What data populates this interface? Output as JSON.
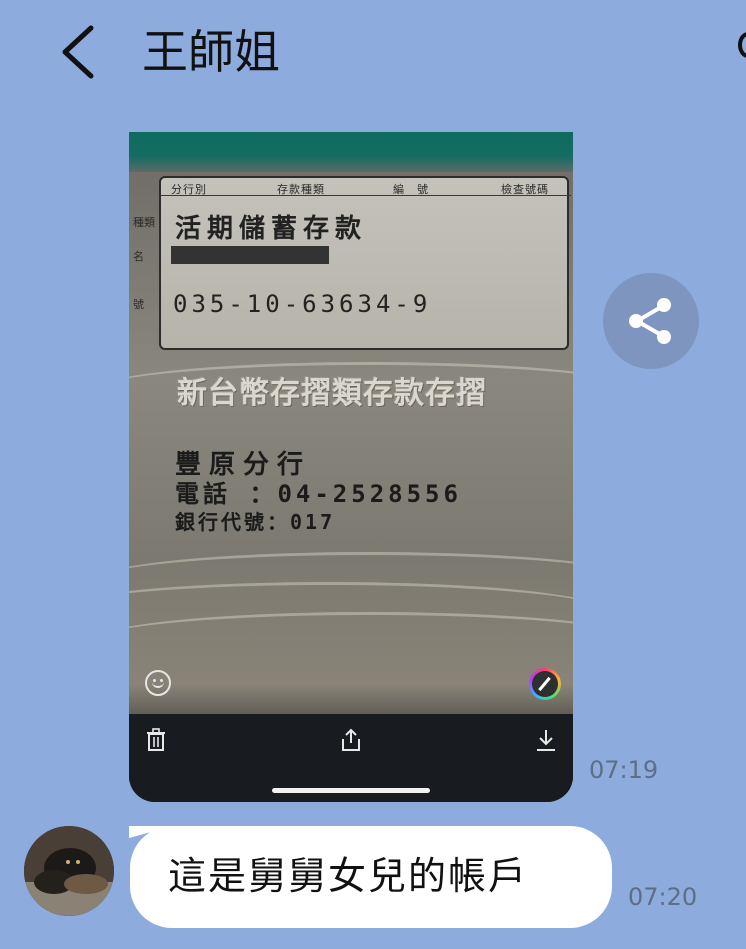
{
  "header": {
    "back_icon": "chevron-left-icon",
    "title": "王師姐"
  },
  "image_message": {
    "slip": {
      "headers": [
        "分行別",
        "存款種類",
        "編　號",
        "檢查號碼"
      ],
      "side_labels": [
        "種類",
        "名",
        "號"
      ],
      "account_type": "活期儲蓄存款",
      "account_number": "035-10-63634-9"
    },
    "book_title": "新台幣存摺類存款存摺",
    "branch_name": "豐原分行",
    "branch_phone": "電話 ：04-2528556",
    "bank_code": "銀行代號：017",
    "controls": {
      "emoji_icon": "smile-icon",
      "edit_icon": "pencil-icon",
      "delete_icon": "trash-icon",
      "share_icon": "upload-icon",
      "download_icon": "download-icon"
    },
    "time": "07:19"
  },
  "share_button": {
    "icon": "share-icon"
  },
  "text_message": {
    "text": "這是舅舅女兒的帳戶",
    "time": "07:20"
  }
}
